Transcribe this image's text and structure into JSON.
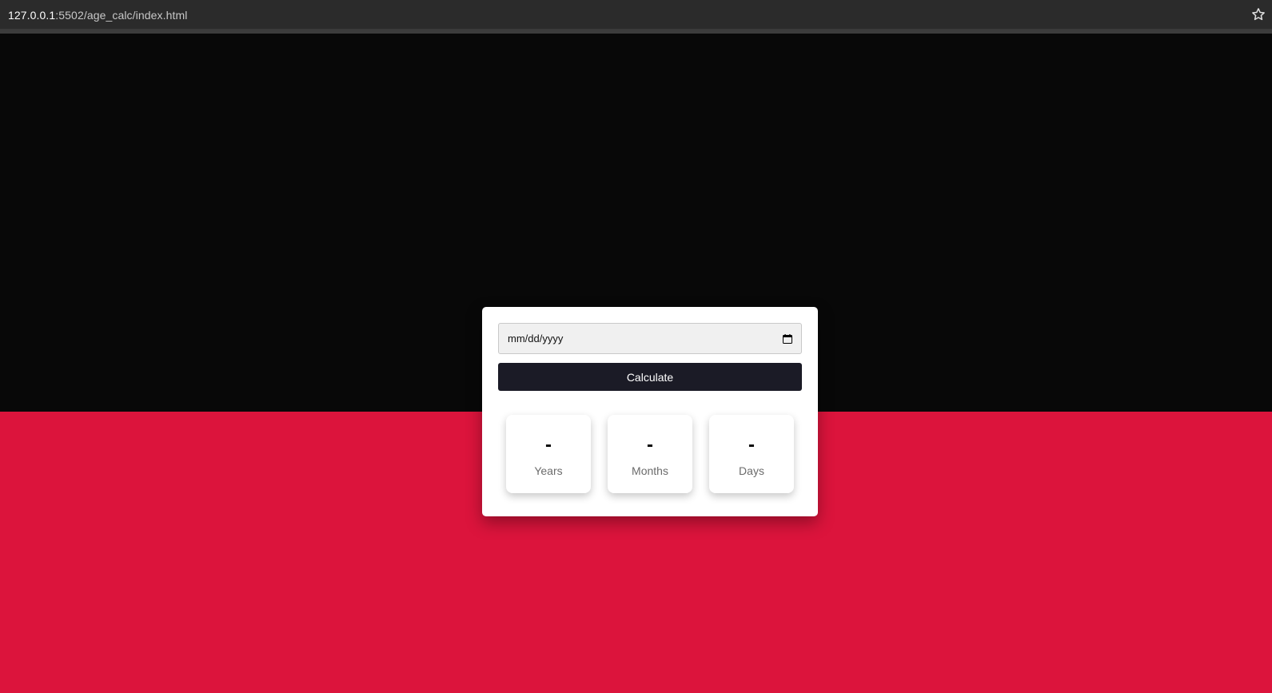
{
  "browser": {
    "url_host": "127.0.0.1",
    "url_path": ":5502/age_calc/index.html",
    "bookmark_icon": "star-icon"
  },
  "colors": {
    "top_background": "#080808",
    "bottom_background": "#dc143c",
    "button_background": "#1b1b26",
    "card_background": "#ffffff"
  },
  "form": {
    "date_placeholder": "mm/dd/yyyy",
    "calendar_icon": "calendar-icon",
    "calculate_label": "Calculate"
  },
  "results": [
    {
      "value": "-",
      "label": "Years"
    },
    {
      "value": "-",
      "label": "Months"
    },
    {
      "value": "-",
      "label": "Days"
    }
  ]
}
